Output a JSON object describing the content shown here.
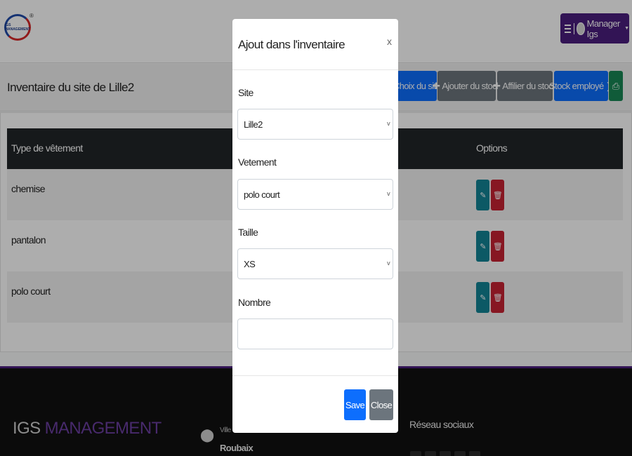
{
  "header": {
    "logo_text": "IGS MANAGEMENT",
    "logo_mark": "®",
    "user_name": "Manager Igs"
  },
  "page": {
    "title": "Inventaire du site de Lille2",
    "actions": [
      {
        "label": "Choix du site",
        "color": "#0d6efd"
      },
      {
        "label": "Ajouter du stock",
        "icon": "plus-icon",
        "color": "#6c757d"
      },
      {
        "label": "Affilier du stock",
        "icon": "plus-icon",
        "color": "#6c757d"
      },
      {
        "label": "Stock employé",
        "icon": "chevron-right-icon",
        "color": "#0d6efd"
      },
      {
        "label": "",
        "icon": "print-icon",
        "color": "#198754"
      }
    ]
  },
  "table": {
    "headers": [
      "Type de vêtement",
      "Options"
    ],
    "rows": [
      {
        "type": "chemise"
      },
      {
        "type": "pantalon"
      },
      {
        "type": "polo court"
      }
    ],
    "edit_color": "#138496",
    "delete_color": "#c82333"
  },
  "footer": {
    "brand_a": "IGS",
    "brand_b": "MANAGEMENT",
    "ville_label": "Ville",
    "ville_value": "Roubaix",
    "social_title": "Réseau sociaux"
  },
  "modal": {
    "title": "Ajout dans l'inventaire",
    "close": "x",
    "fields": {
      "site": {
        "label": "Site",
        "value": "Lille2"
      },
      "vetement": {
        "label": "Vetement",
        "value": "polo court"
      },
      "taille": {
        "label": "Taille",
        "value": "XS"
      },
      "nombre": {
        "label": "Nombre",
        "value": ""
      }
    },
    "save_label": "Save",
    "close_label": "Close",
    "save_color": "#0d6efd",
    "close_color": "#6c757d"
  }
}
